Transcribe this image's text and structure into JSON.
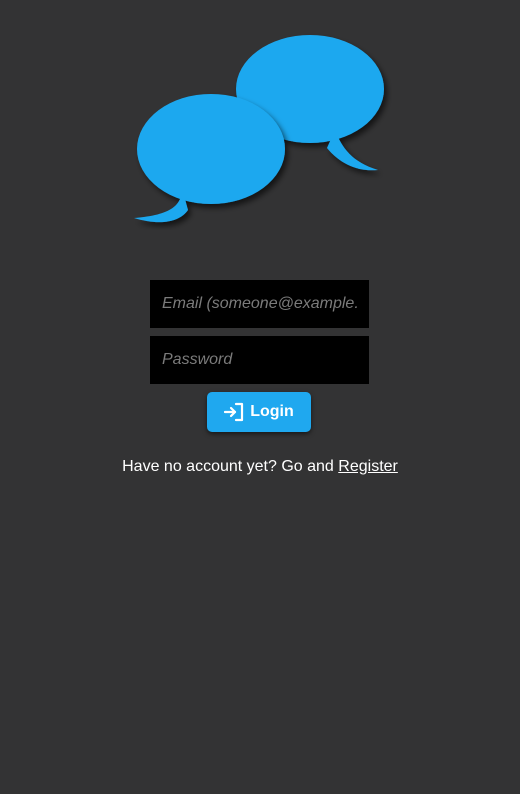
{
  "logo": {
    "icon": "chat-bubbles-icon",
    "color": "#1fa8ef"
  },
  "login_form": {
    "email_placeholder": "Email (someone@example.com)",
    "password_placeholder": "Password",
    "login_label": "Login",
    "login_icon": "sign-in-icon"
  },
  "signup_prompt": {
    "text": "Have no account yet? Go and",
    "link_label": "Register"
  },
  "colors": {
    "background": "#333334",
    "accent": "#1fa8ef",
    "field_background": "#000000",
    "placeholder": "#7b7b7b"
  }
}
